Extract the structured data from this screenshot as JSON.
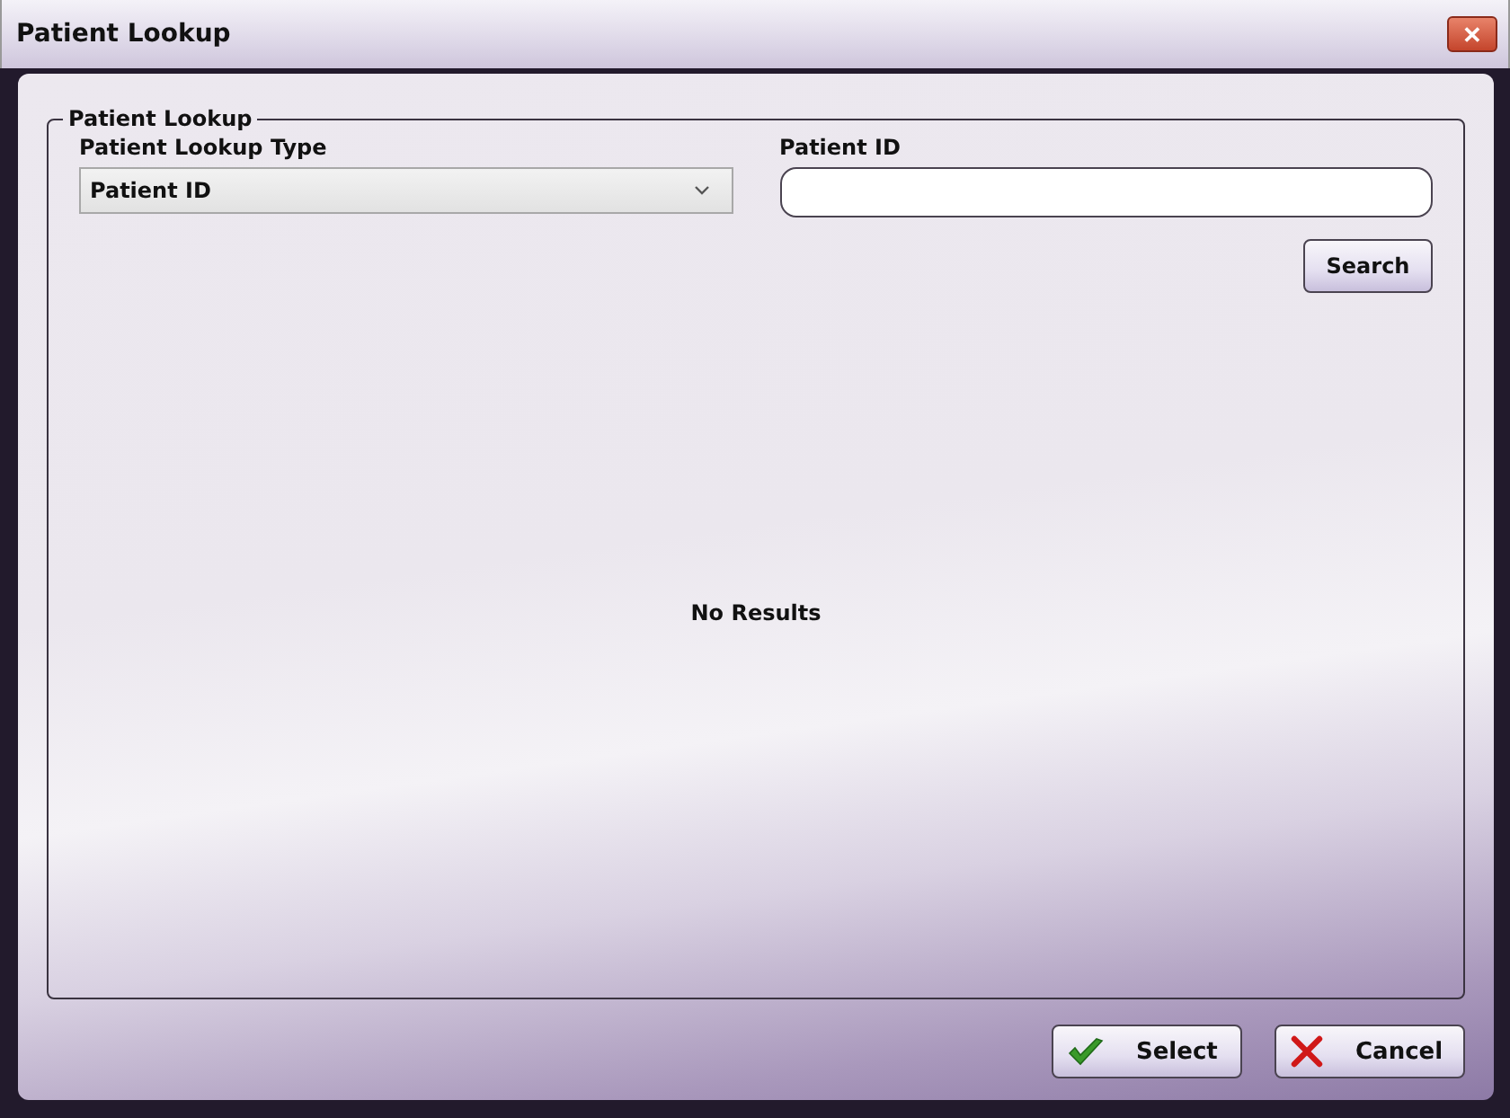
{
  "window": {
    "title": "Patient Lookup",
    "close": "✕"
  },
  "group": {
    "title": "Patient Lookup"
  },
  "lookup_type": {
    "label": "Patient Lookup Type",
    "value": "Patient ID"
  },
  "patient_id": {
    "label": "Patient ID"
  },
  "search_button": "Search",
  "results": {
    "message": "No Results"
  },
  "buttons": [
    {
      "kind": "select",
      "label": "Select"
    },
    {
      "kind": "cancel",
      "label": "Cancel"
    }
  ]
}
